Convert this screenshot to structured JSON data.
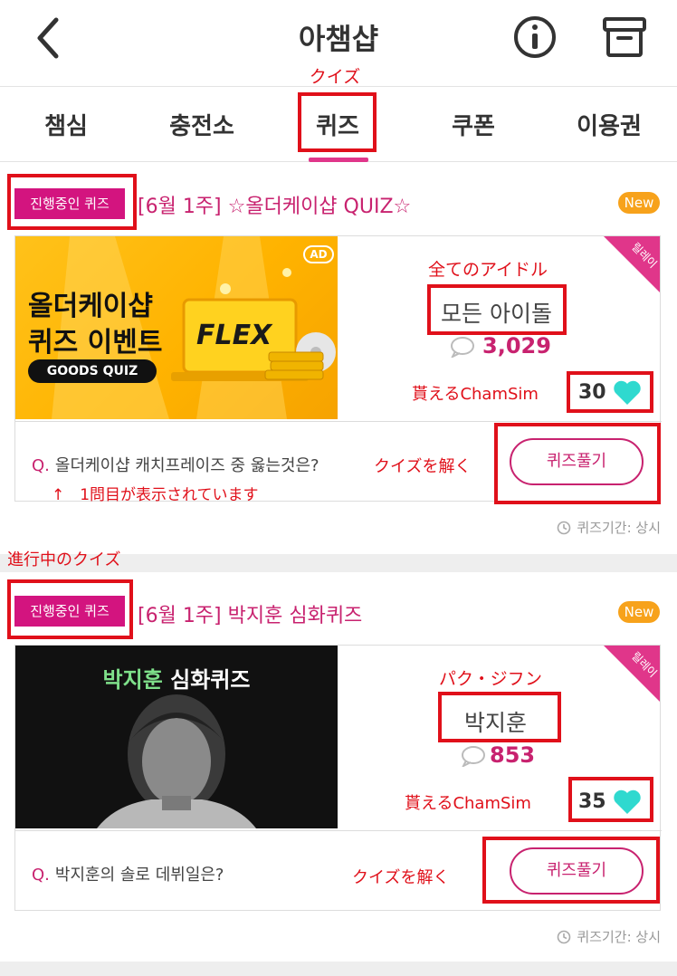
{
  "header": {
    "title": "아챔샵",
    "annotation": "クイズ"
  },
  "tabs": [
    {
      "label": "챔심"
    },
    {
      "label": "충전소"
    },
    {
      "label": "퀴즈"
    },
    {
      "label": "쿠폰"
    },
    {
      "label": "이용권"
    }
  ],
  "section_annotation": "進行中のクイズ",
  "quizzes": [
    {
      "badge": "진행중인 퀴즈",
      "title": "[6월 1주] ☆올더케이샵 QUIZ☆",
      "new": "New",
      "ribbon": "릴레이",
      "banner": {
        "ad": "AD",
        "line1": "올더케이샵",
        "line2": "퀴즈 이벤트",
        "pill": "GOODS QUIZ",
        "flex": "FLEX"
      },
      "target_annotation": "全てのアイドル",
      "target": "모든 아이돌",
      "count": "3,029",
      "reward_annotation": "貰えるChamSim",
      "reward": "30",
      "question_prefix": "Q.",
      "question": "올더케이샵 캐치프레이즈 중 옳는것은?",
      "solve_annotation": "クイズを解く",
      "solve_label": "퀴즈풀기",
      "question_annotation": "↑　1問目が表示されています",
      "period": "퀴즈기간: 상시"
    },
    {
      "badge": "진행중인 퀴즈",
      "title": "[6월 1주] 박지훈 심화퀴즈",
      "new": "New",
      "ribbon": "릴레이",
      "banner": {
        "name": "박지훈",
        "rest": " 심화퀴즈"
      },
      "target_annotation": "パク・ジフン",
      "target": "박지훈",
      "count": "853",
      "reward_annotation": "貰えるChamSim",
      "reward": "35",
      "question_prefix": "Q.",
      "question": "박지훈의 솔로 데뷔일은?",
      "solve_annotation": "クイズを解く",
      "solve_label": "퀴즈풀기",
      "period": "퀴즈기간: 상시"
    }
  ],
  "colors": {
    "accent": "#c8226f",
    "badge": "#d3147f",
    "annotation_red": "#e0101a",
    "heart": "#2fd9cf",
    "new": "#f7a21b"
  },
  "icons": [
    "back-icon",
    "info-icon",
    "archive-icon",
    "chat-icon",
    "heart-icon",
    "clock-icon"
  ]
}
